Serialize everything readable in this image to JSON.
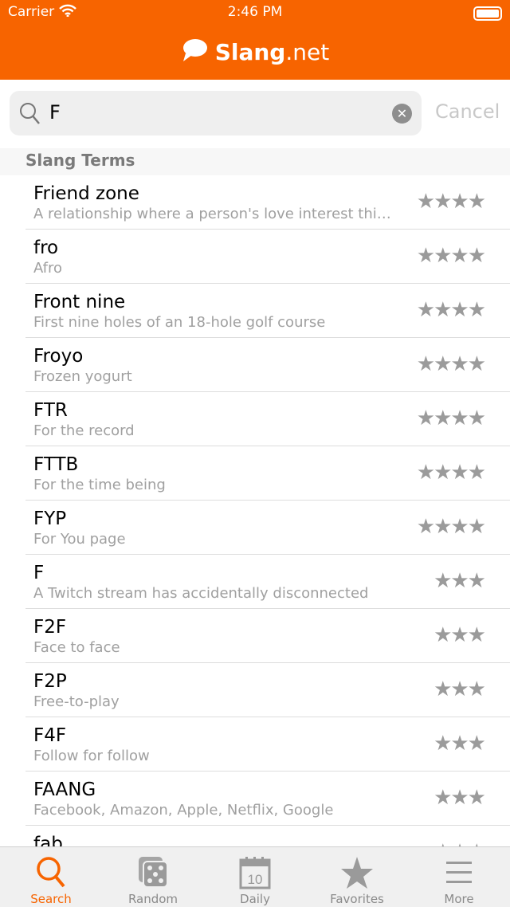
{
  "status": {
    "carrier": "Carrier",
    "time": "2:46 PM"
  },
  "header": {
    "logo_bold": "Slang",
    "logo_light": ".net"
  },
  "search": {
    "value": "F",
    "cancel": "Cancel"
  },
  "section": "Slang Terms",
  "accent": "#f76400",
  "results": [
    {
      "term": "Friend zone",
      "def": "A relationship where a person's love interest thinks of them only as a friend",
      "stars": "★★★★"
    },
    {
      "term": "fro",
      "def": "Afro",
      "stars": "★★★★"
    },
    {
      "term": "Front nine",
      "def": "First nine holes of an 18-hole golf course",
      "stars": "★★★★"
    },
    {
      "term": "Froyo",
      "def": "Frozen yogurt",
      "stars": "★★★★"
    },
    {
      "term": "FTR",
      "def": "For the record",
      "stars": "★★★★"
    },
    {
      "term": "FTTB",
      "def": "For the time being",
      "stars": "★★★★"
    },
    {
      "term": "FYP",
      "def": "For You page",
      "stars": "★★★★"
    },
    {
      "term": "F",
      "def": "A Twitch stream has accidentally disconnected",
      "stars": "★★★"
    },
    {
      "term": "F2F",
      "def": "Face to face",
      "stars": "★★★"
    },
    {
      "term": "F2P",
      "def": "Free-to-play",
      "stars": "★★★"
    },
    {
      "term": "F4F",
      "def": "Follow for follow",
      "stars": "★★★"
    },
    {
      "term": "FAANG",
      "def": "Facebook, Amazon, Apple, Netflix, Google",
      "stars": "★★★"
    },
    {
      "term": "fab",
      "def": "",
      "stars": "★★★"
    }
  ],
  "tabs": [
    {
      "label": "Search",
      "icon": "search-icon"
    },
    {
      "label": "Random",
      "icon": "dice-icon"
    },
    {
      "label": "Daily",
      "icon": "calendar-icon",
      "day": "10"
    },
    {
      "label": "Favorites",
      "icon": "star-icon"
    },
    {
      "label": "More",
      "icon": "menu-icon"
    }
  ]
}
